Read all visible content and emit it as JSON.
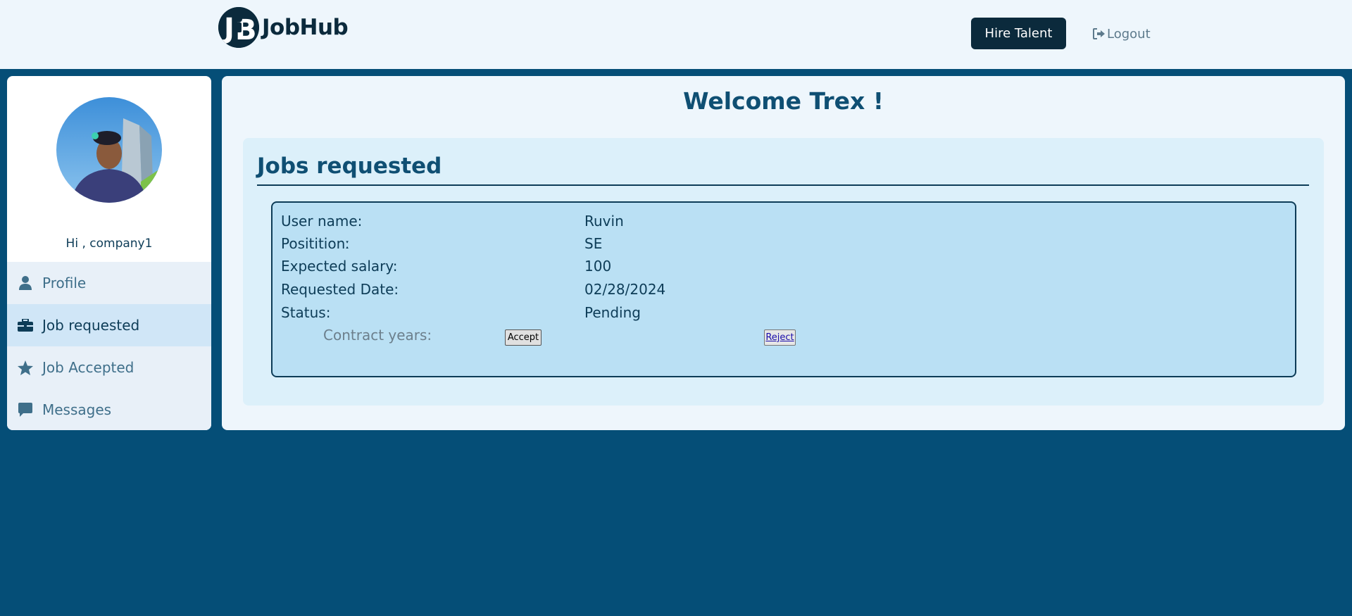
{
  "header": {
    "brand_name": "JobHub",
    "hire_label": "Hire Talent",
    "logout_label": "Logout"
  },
  "sidebar": {
    "greeting": "Hi , company1",
    "items": [
      {
        "label": "Profile",
        "icon": "user-icon"
      },
      {
        "label": "Job requested",
        "icon": "briefcase-icon",
        "active": true
      },
      {
        "label": "Job Accepted",
        "icon": "star-icon"
      },
      {
        "label": "Messages",
        "icon": "message-icon"
      }
    ]
  },
  "main": {
    "welcome": "Welcome Trex !",
    "section_title": "Jobs requested",
    "request": {
      "fields": [
        {
          "label": "User name:",
          "value": "Ruvin"
        },
        {
          "label": "Posititionː",
          "value": "SE"
        },
        {
          "label": "Expected salary:",
          "value": "100"
        },
        {
          "label": "Requested Date:",
          "value": "02/28/2024"
        },
        {
          "label": "Status:",
          "value": "Pending"
        }
      ],
      "contract_label": "Contract years:",
      "accept_label": "Accept",
      "reject_label": "Reject"
    }
  },
  "colors": {
    "page_bg": "#054e77",
    "header_bg": "#eef6fc",
    "dark_navy": "#0b2a3c",
    "accent_blue": "#0f4f73",
    "card_bg": "#bae0f4"
  }
}
